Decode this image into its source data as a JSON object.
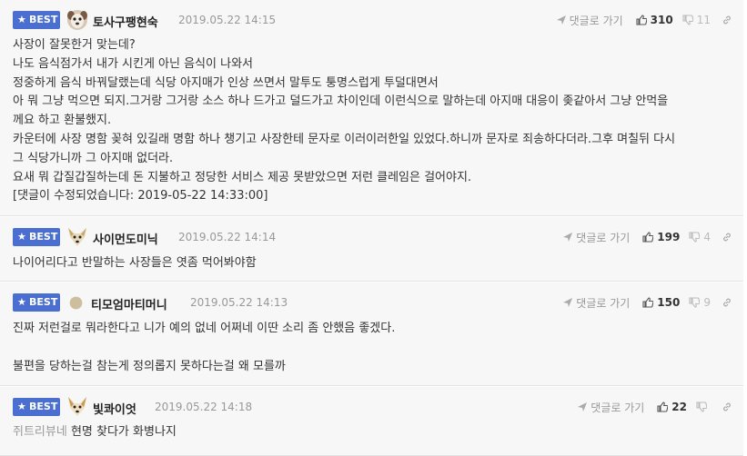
{
  "ui": {
    "best_label": "BEST",
    "reply_label": "댓글로 가기"
  },
  "colors": {
    "best_badge": "#4a6fd1",
    "card_bg": "#f7f7f7",
    "muted_text": "#999999"
  },
  "icons": {
    "best": "star-icon",
    "reply": "send-arrow-icon",
    "upvote": "thumbs-up-icon",
    "downvote": "thumbs-down-icon",
    "permalink": "link-icon"
  },
  "comments": [
    {
      "nickname": "토사구팽현숙",
      "date": "2019.05.22 14:15",
      "up": "310",
      "down": "11",
      "lines": [
        "사장이 잘못한거 맞는데?",
        "나도 음식점가서 내가 시킨게 아닌 음식이 나와서",
        "정중하게 음식 바꿔달랬는데 식당 아지매가 인상 쓰면서 말투도 퉁명스럽게 투덜대면서",
        "아 뭐 그냥 먹으면 되지.그거랑 그거랑 소스 하나 드가고 덜드가고 차이인데 이런식으로 말하는데 아지매 대응이 좆같아서 그냥 안먹을",
        "께요 하고 환불했지.",
        "카운터에 사장 명함 꽂혀 있길래 명함 하나 챙기고 사장한테 문자로 이러이러한일 있었다.하니까 문자로 죄송하다더라.그후 며칠뒤 다시",
        "그 식당가니까 그 아지매 없더라.",
        "요새 뭐 갑질갑질하는데 돈 지불하고 정당한 서비스 제공 못받았으면 저런 클레임은 걸어야지.",
        "[댓글이 수정되었습니다: 2019-05-22 14:33:00]"
      ]
    },
    {
      "nickname": "사이먼도미닉",
      "date": "2019.05.22 14:14",
      "up": "199",
      "down": "4",
      "lines": [
        "나이어리다고 반말하는 사장들은 엿좀 먹어봐야함"
      ]
    },
    {
      "nickname": "티모엄마티머니",
      "date": "2019.05.22 14:13",
      "up": "150",
      "down": "9",
      "lines": [
        "진짜 저런걸로 뭐라한다고 니가 예의 없네 어쩌네 이딴 소리 좀 안했음 좋겠다.",
        "",
        "불편을 당하는걸 참는게 정의롭지 못하다는걸 왜 모를까"
      ]
    },
    {
      "nickname": "빛콰이엇",
      "date": "2019.05.22 14:18",
      "up": "22",
      "down": "",
      "prefix": "쥐트리뷰네",
      "lines": [
        "현명 찾다가 화병나지"
      ]
    }
  ]
}
